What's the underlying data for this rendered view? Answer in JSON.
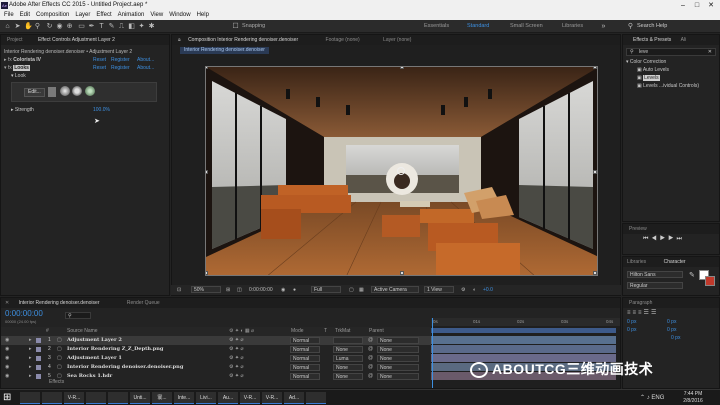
{
  "window": {
    "title": "Adobe After Effects CC 2015 - Untitled Project.aep *",
    "logo": "Ae"
  },
  "menu": [
    "File",
    "Edit",
    "Composition",
    "Layer",
    "Effect",
    "Animation",
    "View",
    "Window",
    "Help"
  ],
  "toolbar": {
    "snapping": "Snapping",
    "workspaces": [
      "Essentials",
      "Standard",
      "Small Screen",
      "Libraries"
    ],
    "search_placeholder": "Search Help"
  },
  "effect_controls": {
    "tabs": [
      "Project",
      "Effect Controls Adjustment Layer 2"
    ],
    "header": "Interior Rendering denoiser.denoiser • Adjustment Layer 2",
    "effects": [
      {
        "name": "Colorista IV",
        "reset": "Reset",
        "register": "Register",
        "about": "About..."
      },
      {
        "name": "Looks",
        "reset": "Reset",
        "register": "Register",
        "about": "About..."
      }
    ],
    "look_label": "Look",
    "edit_button": "Edit...",
    "strength_label": "Strength",
    "strength_value": "100.0%"
  },
  "composition": {
    "tab": "Composition Interior Rendering denoiser.denoiser",
    "footage_tab": "Footage (none)",
    "layer_tab": "Layer (none)",
    "subtab": "Interior Rendering denoiser.denoiser",
    "zoom": "50%",
    "timecode": "0:00:00:00",
    "resolution": "Full",
    "camera": "Active Camera",
    "views": "1 View",
    "exposure": "+0.0"
  },
  "effects_presets": {
    "tabs": [
      "Effects & Presets",
      "Ali"
    ],
    "search_value": "leve",
    "category": "Color Correction",
    "items": [
      "Auto Levels",
      "Levels",
      "Levels ...ividual Controls)"
    ]
  },
  "preview": {
    "title": "Preview"
  },
  "character": {
    "tabs": [
      "Libraries",
      "Character"
    ],
    "font": "Hilton Sans",
    "style": "Regular"
  },
  "paragraph": {
    "title": "Paragraph",
    "indent": [
      "0 px",
      "0 px",
      "0 px",
      "0 px",
      "0 px"
    ]
  },
  "timeline": {
    "tab": "Interior Rendering denoiser.denoiser",
    "render_tab": "Render Queue",
    "timecode": "0:00:00:00",
    "fps": "00000 (24.00 fps)",
    "columns": {
      "source": "Source Name",
      "mode": "Mode",
      "t": "T",
      "trkmat": "TrkMat",
      "parent": "Parent"
    },
    "ruler": [
      "0s",
      "01s",
      "02s",
      "03s",
      "04s"
    ],
    "layers": [
      {
        "num": "1",
        "name": "Adjustment Layer 2",
        "mode": "Normal",
        "trkmat": "",
        "parent": "None"
      },
      {
        "num": "2",
        "name": "Interior Rendering Z_Z_Depth.png",
        "mode": "Normal",
        "trkmat": "None",
        "parent": "None"
      },
      {
        "num": "3",
        "name": "Adjustment Layer 1",
        "mode": "Normal",
        "trkmat": "Luma",
        "parent": "None"
      },
      {
        "num": "4",
        "name": "Interior Rendering denoiser.denoiser.png",
        "mode": "Normal",
        "trkmat": "None",
        "parent": "None"
      },
      {
        "num": "5",
        "name": "Sea Rocks 1.hdr",
        "mode": "Normal",
        "trkmat": "None",
        "parent": "None"
      }
    ],
    "effects_label": "Effects"
  },
  "watermark": "ABOUTCG三维动画技术",
  "taskbar": {
    "items": [
      "",
      "",
      "V-R...",
      "",
      "",
      "Unti...",
      "寰...",
      "Inte...",
      "Livi...",
      "Au...",
      "V-R...",
      "V-R...",
      "Ad...",
      ""
    ],
    "lang": "ENG",
    "time": "7:44 PM",
    "date": "2/8/2016"
  }
}
